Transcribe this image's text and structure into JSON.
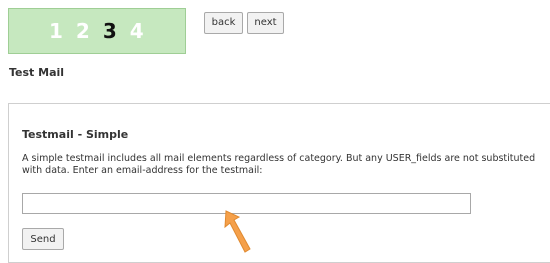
{
  "wizard": {
    "steps": [
      "1",
      "2",
      "3",
      "4"
    ],
    "active_step": 3,
    "back_label": "back",
    "next_label": "next"
  },
  "page": {
    "title": "Test Mail"
  },
  "testmail": {
    "heading": "Testmail - Simple",
    "description": "A simple testmail includes all mail elements regardless of category. But any USER_fields are not substituted with data. Enter an email-address for the testmail:",
    "email_value": "",
    "send_label": "Send"
  },
  "colors": {
    "steps_bg": "#c6e8bf",
    "active_step": "#111111",
    "inactive_step": "#ffffff",
    "pointer_arrow": "#f5a04a"
  },
  "icons": {
    "pointer": "arrow-pointer-icon"
  }
}
